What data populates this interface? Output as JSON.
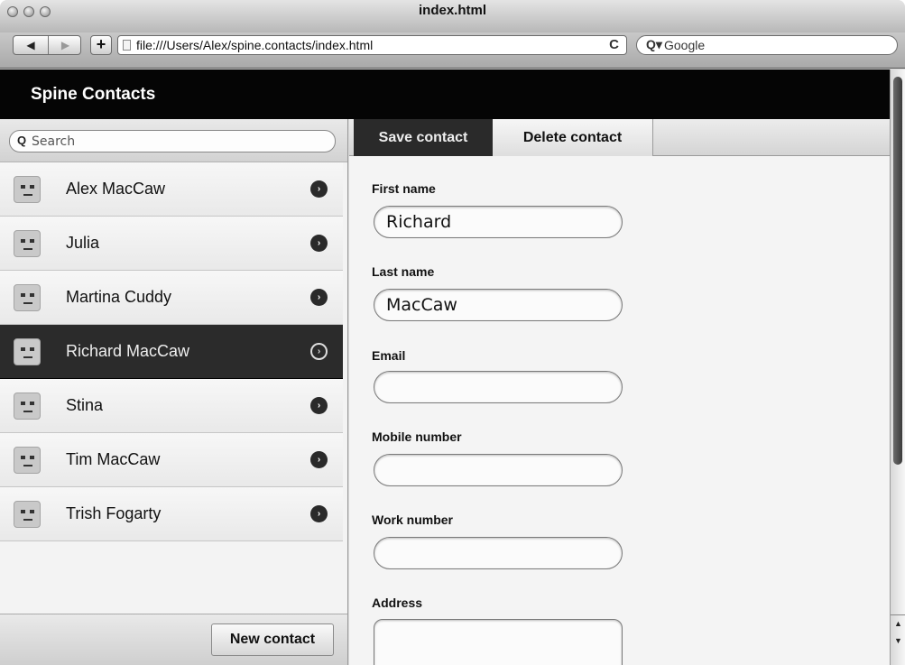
{
  "window": {
    "title": "index.html",
    "back_label": "◀",
    "forward_label": "▶",
    "add_label": "+",
    "address": "file:///Users/Alex/spine.contacts/index.html",
    "reload_label": "C",
    "search_glass": "Q▾",
    "search_label": "Google"
  },
  "app": {
    "title": "Spine Contacts"
  },
  "sidebar": {
    "search_icon": "Q",
    "search_placeholder": "Search",
    "contacts": [
      {
        "name": "Alex MacCaw",
        "active": false
      },
      {
        "name": "Julia",
        "active": false
      },
      {
        "name": "Martina Cuddy",
        "active": false
      },
      {
        "name": "Richard MacCaw",
        "active": true
      },
      {
        "name": "Stina",
        "active": false
      },
      {
        "name": "Tim MacCaw",
        "active": false
      },
      {
        "name": "Trish Fogarty",
        "active": false
      }
    ],
    "chevron_glyph": "›",
    "new_contact_label": "New contact"
  },
  "editor": {
    "save_label": "Save contact",
    "delete_label": "Delete contact",
    "fields": {
      "first_name": {
        "label": "First name",
        "value": "Richard"
      },
      "last_name": {
        "label": "Last name",
        "value": "MacCaw"
      },
      "email": {
        "label": "Email",
        "value": ""
      },
      "mobile": {
        "label": "Mobile number",
        "value": ""
      },
      "work": {
        "label": "Work number",
        "value": ""
      },
      "address": {
        "label": "Address",
        "value": ""
      }
    }
  },
  "scrollbar": {
    "up_glyph": "▲",
    "down_glyph": "▼"
  },
  "colors": {
    "header_bg": "#050505",
    "active_row_bg": "#2b2b2b",
    "save_tab_bg": "#2a2a2a"
  }
}
